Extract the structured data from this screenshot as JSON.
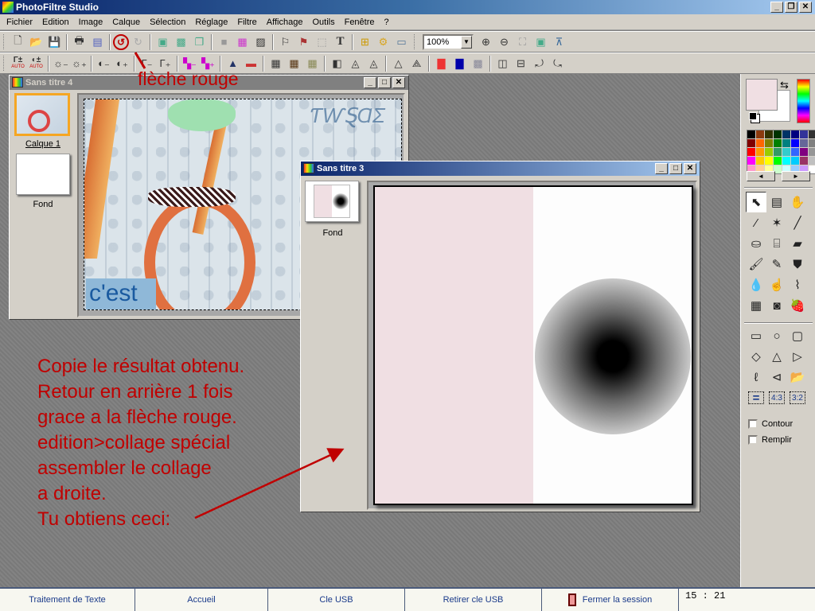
{
  "app": {
    "title": "PhotoFiltre Studio",
    "window_buttons": [
      "_",
      "❐",
      "✕"
    ]
  },
  "menu": [
    "Fichier",
    "Edition",
    "Image",
    "Calque",
    "Sélection",
    "Réglage",
    "Filtre",
    "Affichage",
    "Outils",
    "Fenêtre",
    "?"
  ],
  "toolbar1": {
    "zoom_value": "100%",
    "icons": [
      "new-icon",
      "open-icon",
      "save-icon",
      "print-icon",
      "scan-icon",
      "undo-icon",
      "redo-icon",
      "paste-as-image-icon",
      "transparency-icon",
      "duplicate-icon",
      "gray-square-icon",
      "color-grid-icon",
      "transparent-figure-icon",
      "figure-icon",
      "frame-figure-icon",
      "selection-icon",
      "text-icon",
      "tree-icon",
      "gear-icon",
      "browser-icon",
      "zoom-in-icon",
      "zoom-out-icon",
      "fit-icon",
      "fullscreen-icon",
      "slideshow-icon"
    ],
    "text_tool": "T"
  },
  "toolbar2": {
    "labels": {
      "auto1": "AUTO",
      "auto2": "AUTO"
    }
  },
  "doc4": {
    "title": "Sans titre 4",
    "layers": [
      {
        "name": "Calque 1",
        "selected": true
      },
      {
        "name": "Fond",
        "selected": false
      }
    ],
    "canvas_text": "c'est"
  },
  "doc3": {
    "title": "Sans titre 3",
    "layers": [
      {
        "name": "Fond"
      }
    ],
    "canvas_colors": {
      "left": "#f0dfe3",
      "right": "#fdfdfd"
    }
  },
  "annotations": {
    "arrow_label": "flèche rouge",
    "instructions": [
      "Copie le résultat obtenu.",
      "Retour en arrière 1 fois",
      "grace a la flèche rouge.",
      "edition>collage spécial",
      "assembler le collage",
      "a droite.",
      "Tu obtiens ceci:"
    ],
    "color": "#c00000"
  },
  "colors": {
    "foreground": "#f0dfe3",
    "background": "#ffffff"
  },
  "palette": [
    "#000000",
    "#8b3a0e",
    "#333300",
    "#003300",
    "#003366",
    "#000080",
    "#333399",
    "#333333",
    "#800000",
    "#ff6600",
    "#808000",
    "#008000",
    "#008080",
    "#0000ff",
    "#666699",
    "#808080",
    "#ff0000",
    "#ff9900",
    "#99cc00",
    "#339966",
    "#33cccc",
    "#3366ff",
    "#800080",
    "#969696",
    "#ff00ff",
    "#ffcc00",
    "#ffff00",
    "#00ff00",
    "#00ffff",
    "#00ccff",
    "#993366",
    "#c0c0c0",
    "#ff99cc",
    "#ffcc99",
    "#ffff99",
    "#ccffcc",
    "#ccffff",
    "#99ccff",
    "#cc99ff",
    "#ffffff"
  ],
  "tools": [
    "pointer-icon",
    "selection-tool-icon",
    "hand-icon",
    "eyedropper-icon",
    "magic-wand-icon",
    "line-icon",
    "fill-bucket-icon",
    "spray-icon",
    "eraser-icon",
    "brush-icon",
    "advanced-brush-icon",
    "stamp-icon",
    "blur-drop-icon",
    "smudge-finger-icon",
    "deform-brush-icon",
    "mesh-icon",
    "portrait-icon",
    "strawberry-icon"
  ],
  "shapes": [
    "rectangle-icon",
    "ellipse-icon",
    "rounded-rect-icon",
    "diamond-icon",
    "triangle-icon",
    "triangle-right-icon",
    "lasso-icon",
    "polygon-lasso-icon",
    "open-folder-icon",
    "ratio-equal-icon",
    "ratio-4-3-icon",
    "ratio-3-2-icon"
  ],
  "shape_labels": {
    "r43": "4:3",
    "r32": "3:2"
  },
  "options": {
    "contour": "Contour",
    "fill": "Remplir"
  },
  "taskbar": {
    "items": [
      "Traitement de Texte",
      "Accueil",
      "Cle USB",
      "Retirer cle USB",
      "Fermer la session"
    ],
    "clock": "15 : 21"
  }
}
